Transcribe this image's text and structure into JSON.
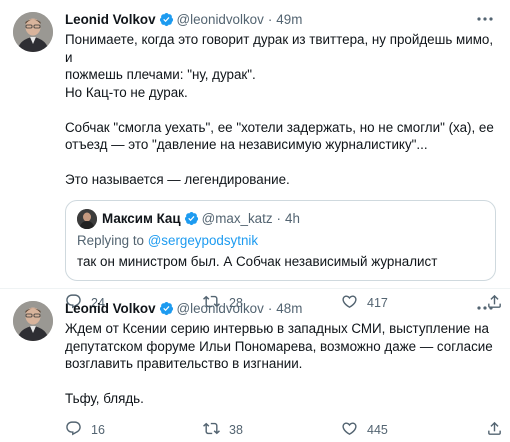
{
  "tweets": [
    {
      "author": {
        "name": "Leonid Volkov",
        "handle": "@leonidvolkov",
        "time": "49m"
      },
      "separator": "·",
      "text": "Понимаете, когда это говорит дурак из твиттера, ну пройдешь мимо, и\nпожмешь плечами: \"ну, дурак\".\nНо Кац-то не дурак.\n\nСобчак \"смогла уехать\", ее \"хотели задержать, но не смогли\" (ха), ее\nотъезд — это \"давление на независимую журналистику\"...\n\nЭто называется — легендирование.",
      "quote": {
        "author": {
          "name": "Максим Кац",
          "handle": "@max_katz",
          "time": "4h"
        },
        "replying_prefix": "Replying to ",
        "replying_to": "@sergeypodsytnik",
        "text": "так он министром был. А Собчак независимый журналист"
      },
      "stats": {
        "replies": "24",
        "retweets": "28",
        "likes": "417"
      }
    },
    {
      "author": {
        "name": "Leonid Volkov",
        "handle": "@leonidvolkov",
        "time": "48m"
      },
      "separator": "·",
      "text": "Ждем от Ксении серию интервью в западных СМИ, выступление на\nдепутатском форуме Ильи Пономарева, возможно даже — согласие\nвозглавить правительство в изгнании.\n\nТьфу, блядь.",
      "stats": {
        "replies": "16",
        "retweets": "38",
        "likes": "445"
      }
    }
  ],
  "colors": {
    "text": "#0f1419",
    "secondary": "#536471",
    "accent": "#1d9bf0",
    "border": "#cfd9de",
    "divider": "#eff3f4"
  },
  "icons": [
    "verified-icon",
    "more-icon",
    "reply-icon",
    "retweet-icon",
    "like-icon",
    "share-icon"
  ]
}
